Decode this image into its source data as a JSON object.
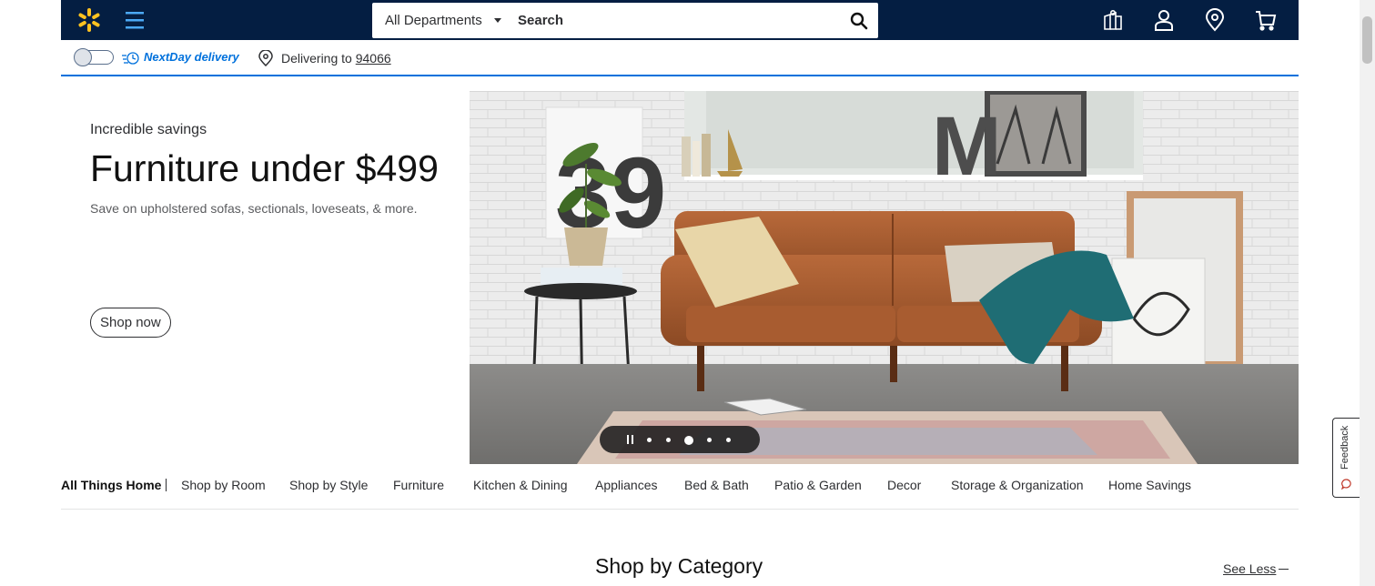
{
  "header": {
    "logo": "walmart-spark-icon",
    "brand_color": "#041e42",
    "spark_color": "#ffc220",
    "menu_icon": "hamburger-icon",
    "search": {
      "department": "All Departments",
      "placeholder": "Search"
    },
    "icons": [
      "reorder-icon",
      "account-icon",
      "store-location-icon",
      "cart-icon"
    ]
  },
  "delivery_bar": {
    "toggle_state": "off",
    "nextday_label": "NextDay delivery",
    "delivering_to": "Delivering to",
    "zip": "94066",
    "accent_color": "#0071dc"
  },
  "hero": {
    "eyebrow": "Incredible savings",
    "title": "Furniture under $499",
    "subtitle": "Save on upholstered sofas, sectionals, loveseats, & more.",
    "cta": "Shop now",
    "image": "leather-sofa-living-room-photo",
    "carousel": {
      "slides": 5,
      "active": 3
    }
  },
  "category_nav": {
    "current": "All Things Home",
    "items": [
      "Shop by Room",
      "Shop by Style",
      "Furniture",
      "Kitchen & Dining",
      "Appliances",
      "Bed & Bath",
      "Patio & Garden",
      "Decor",
      "Storage & Organization",
      "Home Savings"
    ]
  },
  "section": {
    "title": "Shop by Category",
    "toggle": "See Less"
  },
  "feedback": {
    "label": "Feedback"
  }
}
